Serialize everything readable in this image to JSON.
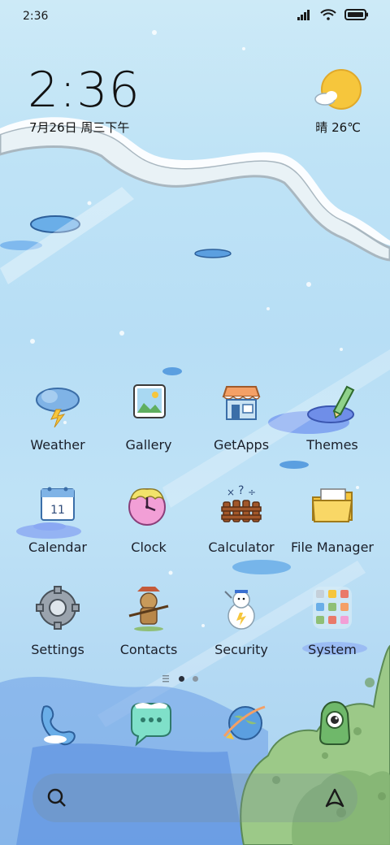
{
  "status": {
    "time": "2:36"
  },
  "lock": {
    "clock": "2:36",
    "date": "7月26日 周三下午",
    "weather": "晴 26℃"
  },
  "apps": [
    {
      "label": "Weather",
      "icon": "weather-icon"
    },
    {
      "label": "Gallery",
      "icon": "gallery-icon"
    },
    {
      "label": "GetApps",
      "icon": "getapps-icon"
    },
    {
      "label": "Themes",
      "icon": "themes-icon"
    },
    {
      "label": "Calendar",
      "icon": "calendar-icon",
      "calendar_day": "11"
    },
    {
      "label": "Clock",
      "icon": "clock-icon"
    },
    {
      "label": "Calculator",
      "icon": "calculator-icon"
    },
    {
      "label": "File Manager",
      "icon": "file-manager-icon"
    },
    {
      "label": "Settings",
      "icon": "settings-icon"
    },
    {
      "label": "Contacts",
      "icon": "contacts-icon"
    },
    {
      "label": "Security",
      "icon": "security-icon"
    },
    {
      "label": "System",
      "icon": "system-folder-icon"
    }
  ],
  "dock": [
    {
      "icon": "phone-icon"
    },
    {
      "icon": "messages-icon"
    },
    {
      "icon": "browser-icon"
    },
    {
      "icon": "camera-icon"
    }
  ],
  "pager": {
    "pages": 2,
    "current": 1
  },
  "colors": {
    "sky": "#bfe3f6",
    "snow": "#f7fbff",
    "bush": "#8fbf76",
    "accent_blue": "#3a7bd5",
    "sun": "#f6c63c"
  }
}
